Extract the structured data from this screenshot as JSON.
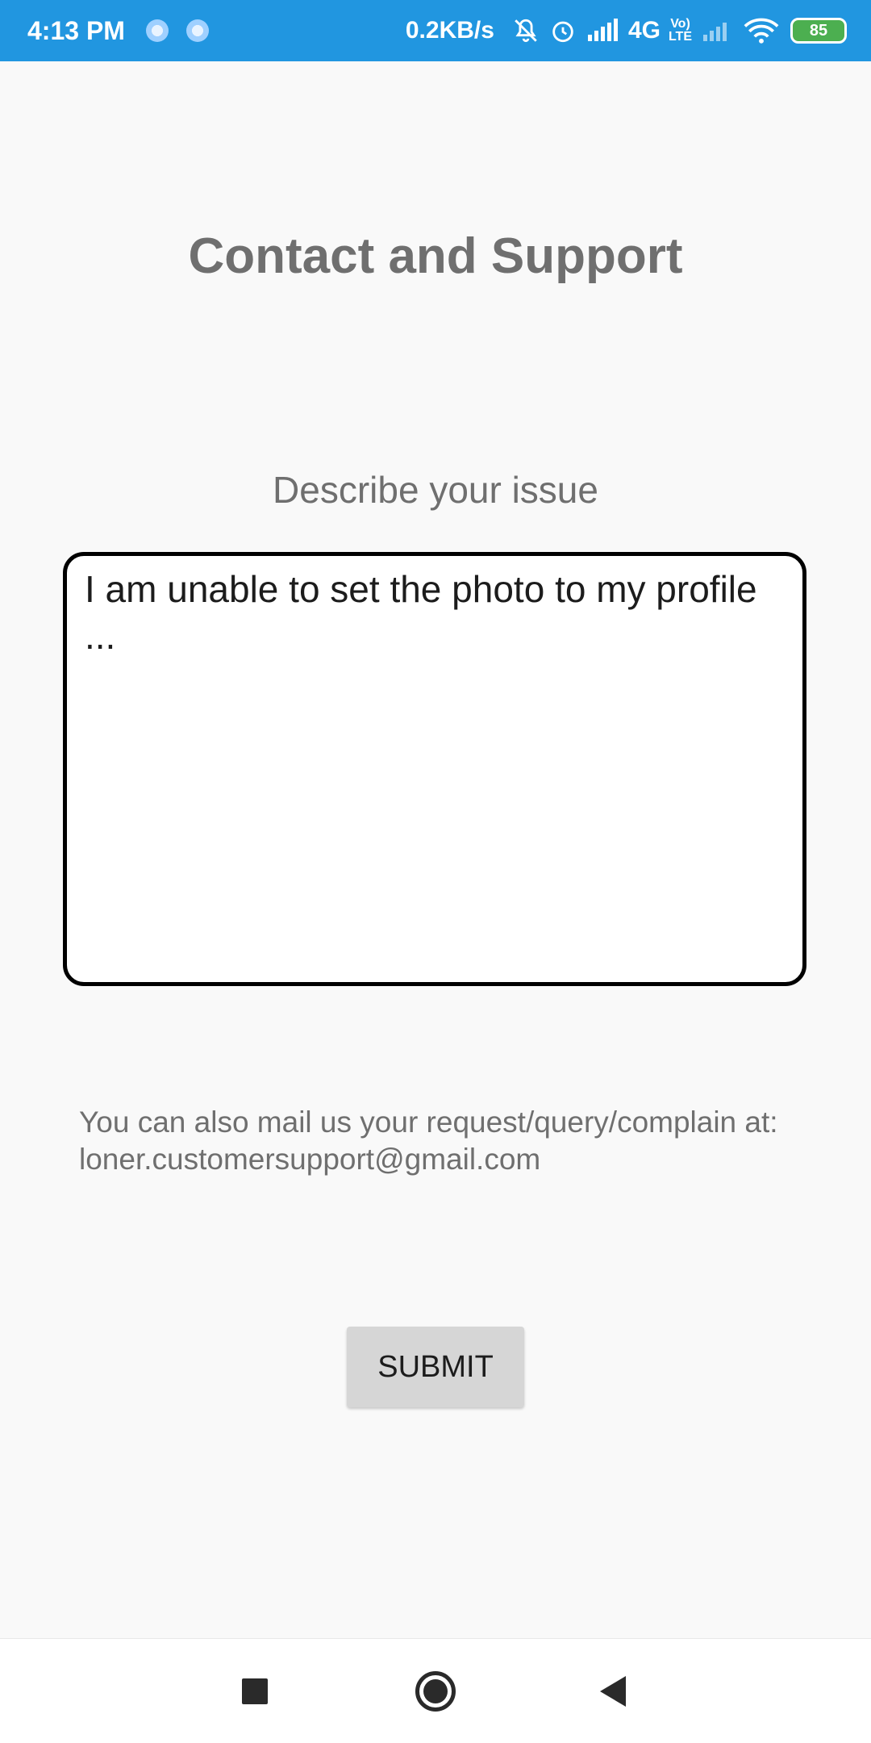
{
  "status_bar": {
    "time": "4:13 PM",
    "speed": "0.2KB/s",
    "network": "4G",
    "volte_top": "Vo)",
    "volte_bottom": "LTE",
    "battery": "85"
  },
  "page": {
    "title": "Contact and Support",
    "issue_label": "Describe your issue",
    "issue_text": "I am unable to set the photo to my profile ...",
    "mail_info": "You can also mail us your request/query/complain at: loner.customersupport@gmail.com",
    "submit_label": "SUBMIT"
  },
  "nav_bar": {
    "recent_icon": "square-recent-icon",
    "home_icon": "circle-home-icon",
    "back_icon": "triangle-back-icon"
  }
}
